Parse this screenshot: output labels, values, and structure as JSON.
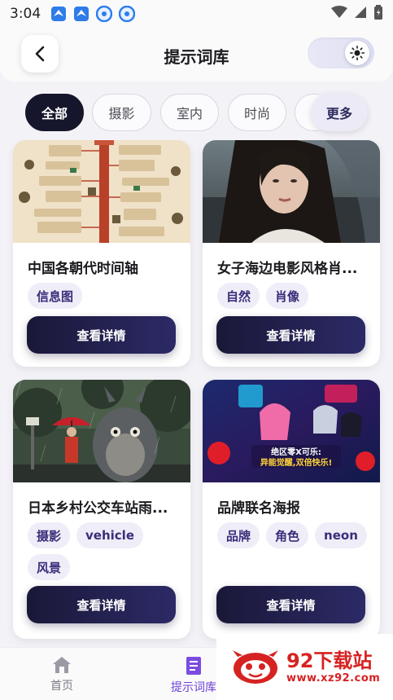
{
  "status_bar": {
    "time": "3:04"
  },
  "header": {
    "title": "提示词库"
  },
  "filters": [
    {
      "label": "全部",
      "active": true
    },
    {
      "label": "摄影",
      "active": false
    },
    {
      "label": "室内",
      "active": false
    },
    {
      "label": "时尚",
      "active": false
    }
  ],
  "filters_more": "更多",
  "cards": [
    {
      "name": "中国各朝代时间轴",
      "tags": [
        "信息图"
      ],
      "button": "查看详情"
    },
    {
      "name": "女子海边电影风格肖...",
      "tags": [
        "自然",
        "肖像"
      ],
      "button": "查看详情"
    },
    {
      "name": "日本乡村公交车站雨...",
      "tags": [
        "摄影",
        "vehicle",
        "风景"
      ],
      "button": "查看详情"
    },
    {
      "name": "品牌联名海报",
      "tags": [
        "品牌",
        "角色",
        "neon"
      ],
      "button": "查看详情"
    }
  ],
  "card_images": {
    "poster_caption_1": "绝区零X可乐:",
    "poster_caption_2": "异能觉醒,双倍快乐!"
  },
  "bottom_nav": [
    {
      "label": "首页",
      "icon": "home-icon",
      "active": false
    },
    {
      "label": "提示词库",
      "icon": "document-icon",
      "active": true
    }
  ],
  "watermark": {
    "brand": "92下载站",
    "url": "www.xz92.com"
  },
  "colors": {
    "accent": "#15152b",
    "tag_bg": "#efedf8",
    "tag_text": "#3b2d7a",
    "nav_active": "#6d3fd8",
    "watermark_red": "#d72222"
  }
}
